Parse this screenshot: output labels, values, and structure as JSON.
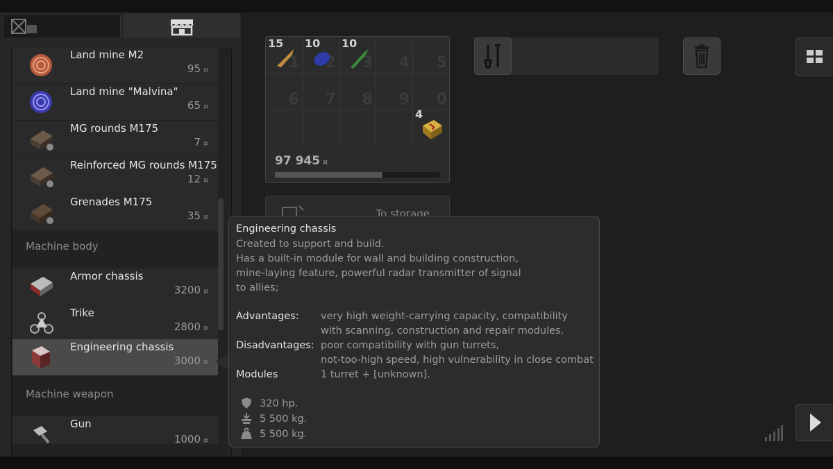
{
  "tabs": [
    {
      "icon": "garage-icon"
    },
    {
      "icon": "shop-icon"
    }
  ],
  "currency_symbol": "¤",
  "shop_list": {
    "items": [
      {
        "name": "Land mine M2",
        "price": "95",
        "icon": "land-mine-icon"
      },
      {
        "name": "Land mine \"Malvina\"",
        "price": "65",
        "icon": "land-mine-malvina-icon"
      },
      {
        "name": "MG rounds M175",
        "price": "7",
        "icon": "ammo-box-icon"
      },
      {
        "name": "Reinforced MG rounds M175",
        "price": "12",
        "icon": "ammo-box-icon"
      },
      {
        "name": "Grenades M175",
        "price": "35",
        "icon": "grenade-box-icon"
      }
    ],
    "section_body": "Machine body",
    "body_items": [
      {
        "name": "Armor chassis",
        "price": "3200",
        "icon": "armor-chassis-icon"
      },
      {
        "name": "Trike",
        "price": "2800",
        "icon": "trike-icon"
      },
      {
        "name": "Engineering chassis",
        "price": "3000",
        "icon": "engineering-chassis-icon",
        "selected": true
      }
    ],
    "section_weapon": "Machine weapon",
    "weapon_items": [
      {
        "name": "Gun",
        "price": "1000",
        "icon": "gun-icon"
      }
    ]
  },
  "inventory": {
    "slot_numbers": [
      "1",
      "2",
      "3",
      "4",
      "5",
      "6",
      "7",
      "8",
      "9",
      "0"
    ],
    "slots": [
      {
        "qty": "15",
        "icon": "bullet-icon"
      },
      {
        "qty": "10",
        "icon": "blue-mine-icon"
      },
      {
        "qty": "10",
        "icon": "green-rocket-icon"
      },
      {
        "qty": "4",
        "icon": "ammo-crate-icon"
      }
    ],
    "money": "97 945",
    "capacity_fraction": 0.65,
    "to_storage": "To storage"
  },
  "tooltip": {
    "title": "Engineering chassis",
    "description": [
      "Created to support and build.",
      "Has a built-in module for wall and building construction,",
      "mine-laying feature, powerful radar transmitter of signal",
      "to allies;"
    ],
    "advantages_label": "Advantages:",
    "advantages": [
      "very high weight-carrying capacity, compatibility",
      "with scanning, construction and repair modules."
    ],
    "disadvantages_label": "Disadvantages:",
    "disadvantages": [
      "poor compatibility with gun turrets,",
      "not-too-high speed, high vulnerability in close combat"
    ],
    "modules_label": "Modules",
    "modules": "1 turret + [unknown].",
    "stats": {
      "hp": "320 hp.",
      "capacity": "5 500 kg.",
      "weight": "5 500 kg."
    }
  },
  "colors": {
    "background": "#1e1e1e",
    "panel": "#262626",
    "selected_row": "#4a4a4a",
    "text": "#e6e6e6",
    "muted": "#9c9c9c"
  }
}
